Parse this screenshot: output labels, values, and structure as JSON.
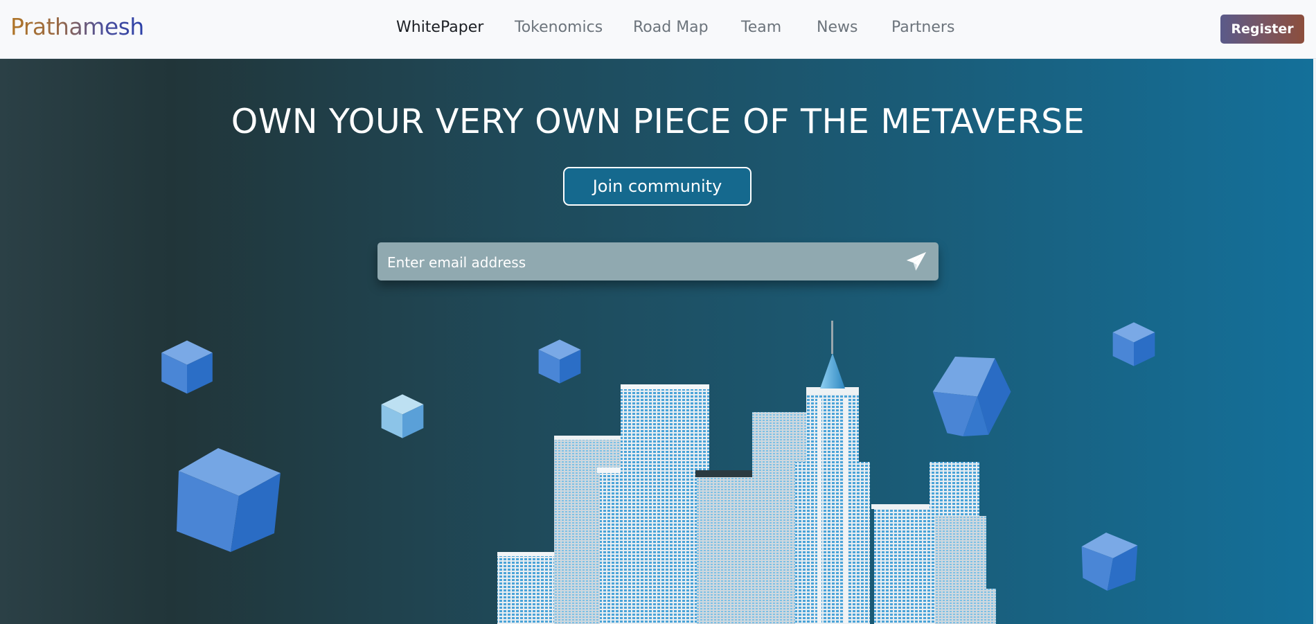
{
  "brand": {
    "name": "Prathamesh"
  },
  "nav": {
    "items": [
      {
        "label": "WhitePaper",
        "active": true
      },
      {
        "label": "Tokenomics",
        "active": false
      },
      {
        "label": "Road Map",
        "active": false
      },
      {
        "label": "Team",
        "active": false
      },
      {
        "label": "News",
        "active": false
      },
      {
        "label": "Partners",
        "active": false
      }
    ],
    "register_label": "Register"
  },
  "hero": {
    "title": "OWN YOUR VERY OWN PIECE OF THE METAVERSE",
    "join_label": "Join community",
    "email_placeholder": "Enter email address",
    "send_icon": "paper-plane-icon"
  },
  "colors": {
    "brand_gradient_start": "#b07526",
    "brand_gradient_end": "#2a3fa8",
    "register_gradient_start": "#5a5a8a",
    "register_gradient_end": "#8c4e3c",
    "join_button": "#15698e",
    "email_bar": "#90a9b0",
    "cube_blue": "#2f73c9"
  }
}
